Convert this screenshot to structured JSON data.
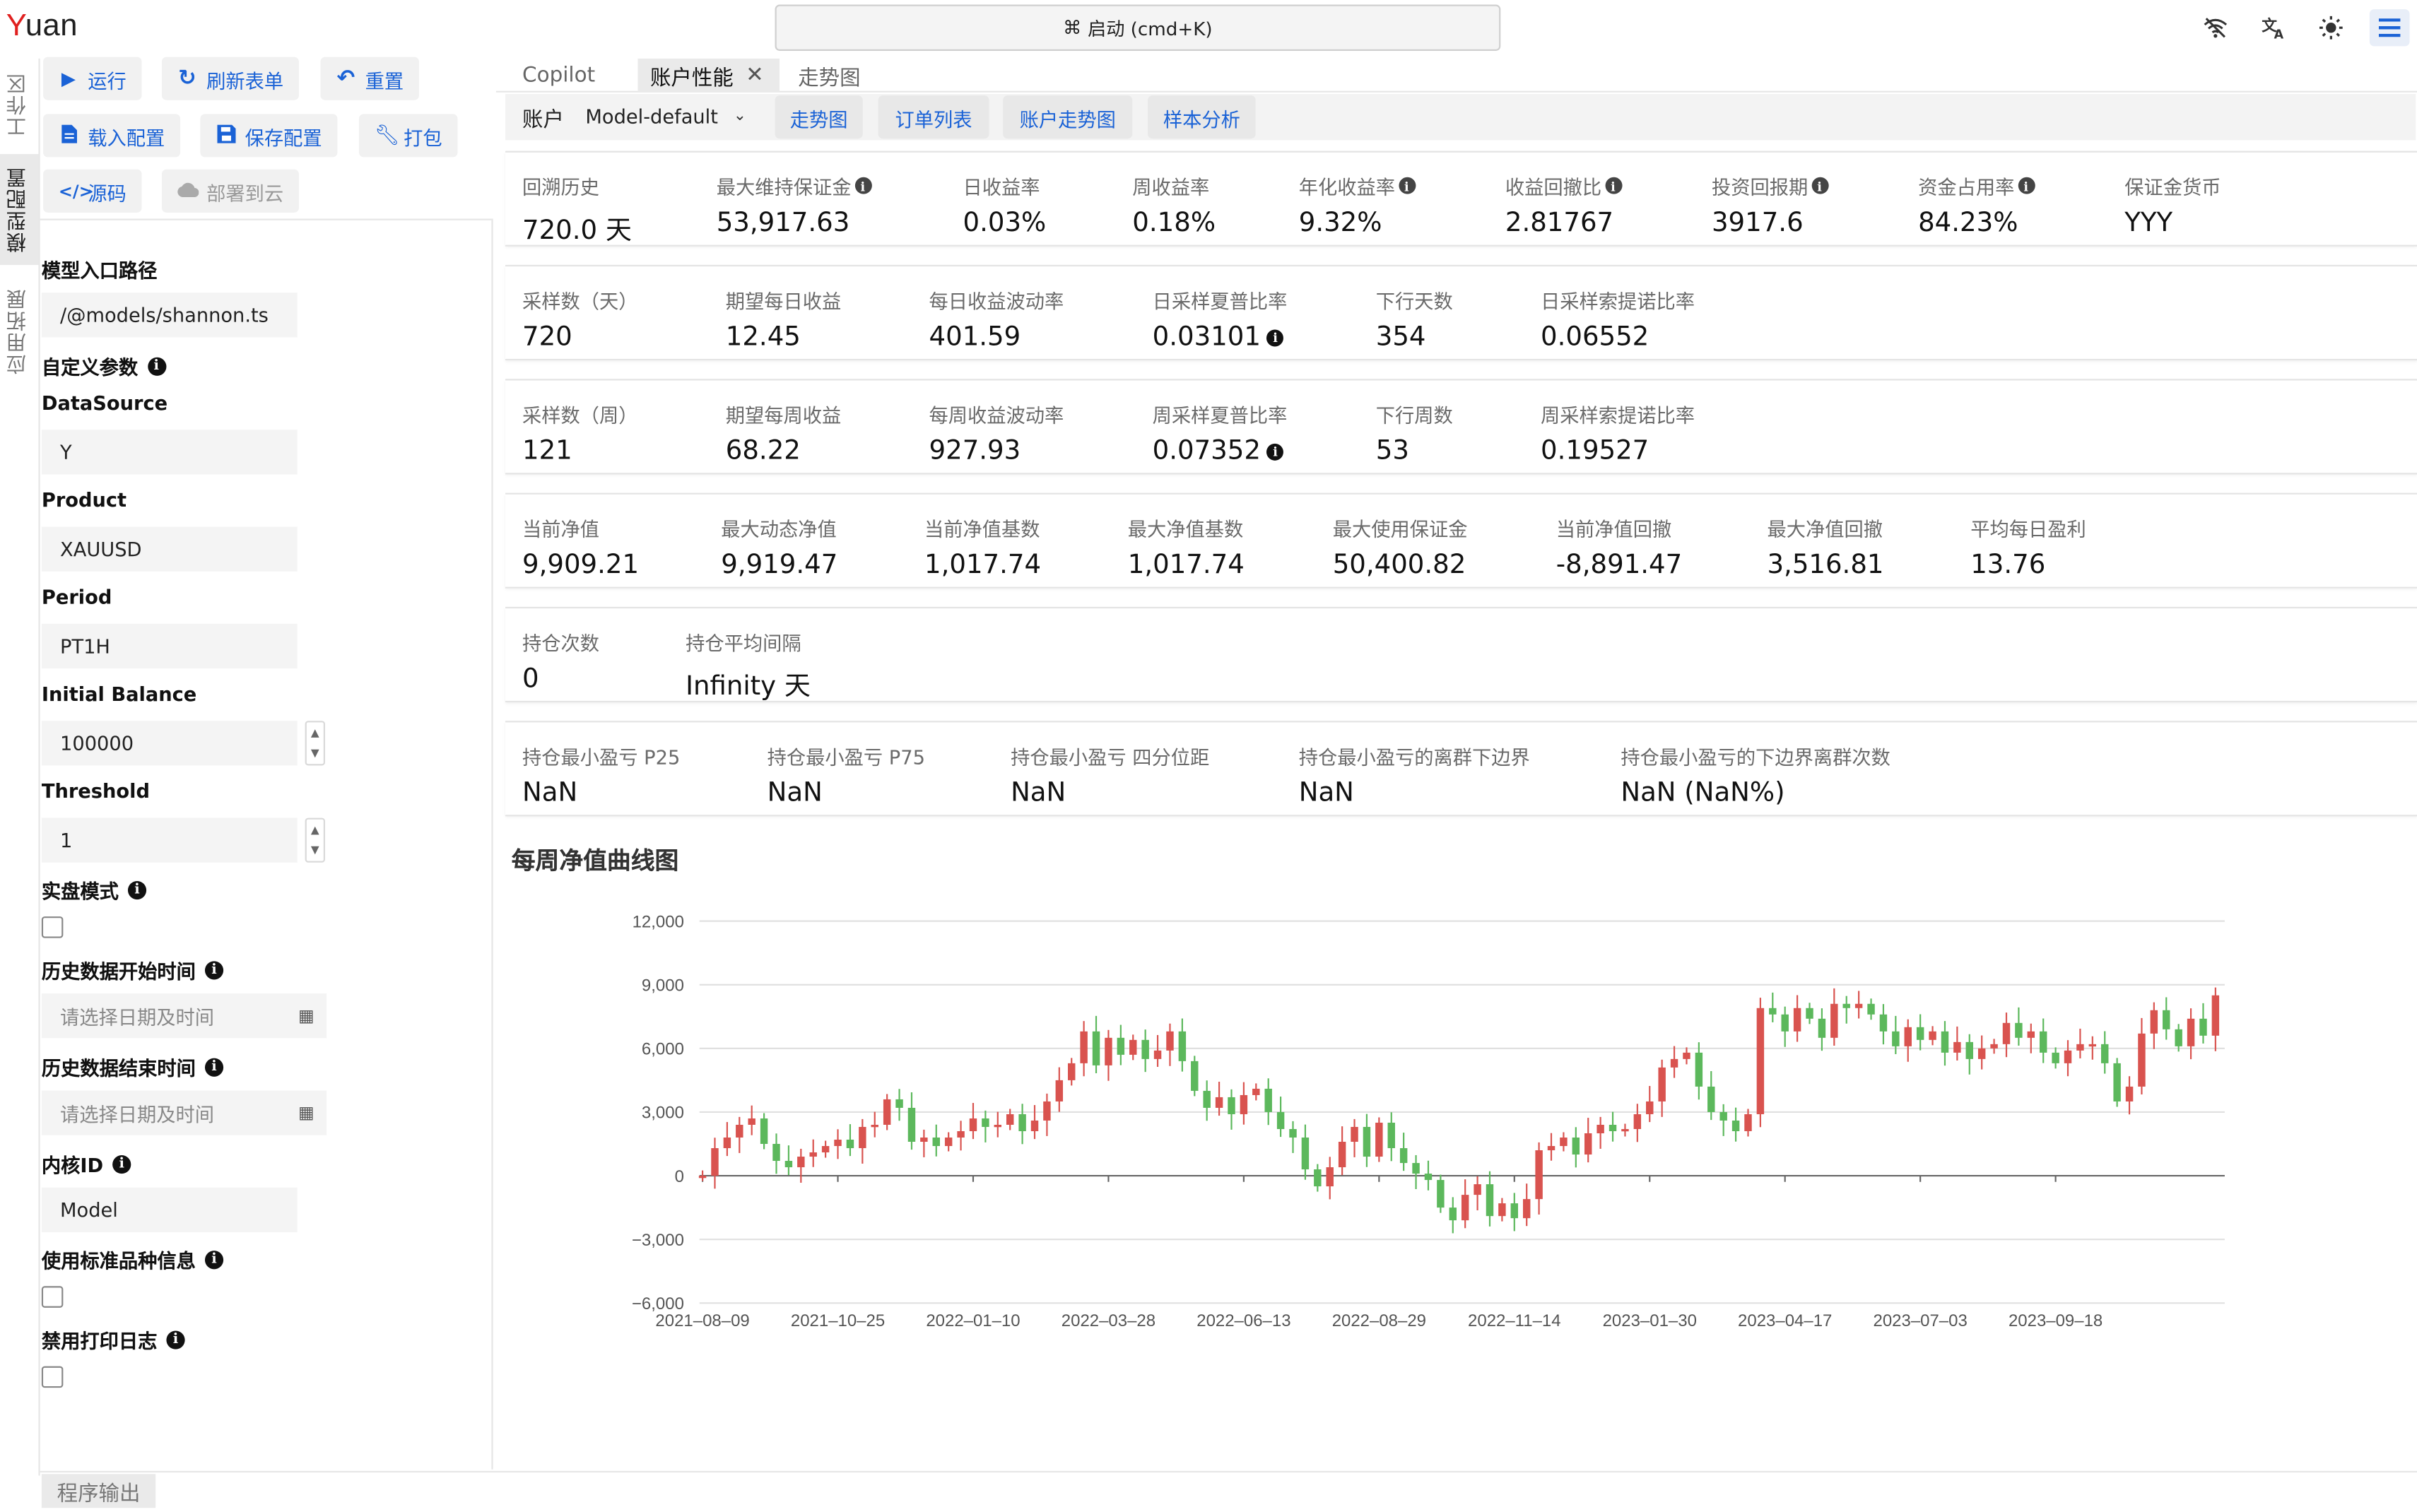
{
  "app": {
    "logo_first": "Y",
    "logo_rest": "uan"
  },
  "command": {
    "glyph": "⌘",
    "label": "启动 (cmd+K)"
  },
  "side_tabs": [
    "工作区",
    "模型配置",
    "应用拓展"
  ],
  "toolbar": {
    "run": "运行",
    "refresh": "刷新表单",
    "reset": "重置",
    "load": "载入配置",
    "save": "保存配置",
    "pack": "打包",
    "source": "源码",
    "deploy": "部署到云"
  },
  "form": {
    "entry_label": "模型入口路径",
    "entry_value": "/@models/shannon.ts",
    "custom_label": "自定义参数",
    "datasource_label": "DataSource",
    "datasource_value": "Y",
    "product_label": "Product",
    "product_value": "XAUUSD",
    "period_label": "Period",
    "period_value": "PT1H",
    "balance_label": "Initial Balance",
    "balance_value": "100000",
    "threshold_label": "Threshold",
    "threshold_value": "1",
    "live_label": "实盘模式",
    "start_label": "历史数据开始时间",
    "start_placeholder": "请选择日期及时间",
    "end_label": "历史数据结束时间",
    "end_placeholder": "请选择日期及时间",
    "kernel_label": "内核ID",
    "kernel_value": "Model",
    "std_label": "使用标准品种信息",
    "nolog_label": "禁用打印日志"
  },
  "main_tabs": [
    "Copilot",
    "账户性能",
    "走势图"
  ],
  "account": {
    "label": "账户",
    "select": "Model-default",
    "buttons": [
      "走势图",
      "订单列表",
      "账户走势图",
      "样本分析"
    ]
  },
  "cards": [
    [
      {
        "k": "回溯历史",
        "v": "720.0 天"
      },
      {
        "k": "最大维持保证金",
        "v": "53,917.63",
        "ki": true
      },
      {
        "k": "日收益率",
        "v": "0.03%"
      },
      {
        "k": "周收益率",
        "v": "0.18%"
      },
      {
        "k": "年化收益率",
        "v": "9.32%",
        "ki": true
      },
      {
        "k": "收益回撤比",
        "v": "2.81767",
        "ki": true
      },
      {
        "k": "投资回报期",
        "v": "3917.6",
        "ki": true
      },
      {
        "k": "资金占用率",
        "v": "84.23%",
        "ki": true
      },
      {
        "k": "保证金货币",
        "v": "YYY"
      }
    ],
    [
      {
        "k": "采样数（天）",
        "v": "720"
      },
      {
        "k": "期望每日收益",
        "v": "12.45"
      },
      {
        "k": "每日收益波动率",
        "v": "401.59"
      },
      {
        "k": "日采样夏普比率",
        "v": "0.03101",
        "vi": true
      },
      {
        "k": "下行天数",
        "v": "354"
      },
      {
        "k": "日采样索提诺比率",
        "v": "0.06552"
      }
    ],
    [
      {
        "k": "采样数（周）",
        "v": "121"
      },
      {
        "k": "期望每周收益",
        "v": "68.22"
      },
      {
        "k": "每周收益波动率",
        "v": "927.93"
      },
      {
        "k": "周采样夏普比率",
        "v": "0.07352",
        "vi": true
      },
      {
        "k": "下行周数",
        "v": "53"
      },
      {
        "k": "周采样索提诺比率",
        "v": "0.19527"
      }
    ],
    [
      {
        "k": "当前净值",
        "v": "9,909.21"
      },
      {
        "k": "最大动态净值",
        "v": "9,919.47"
      },
      {
        "k": "当前净值基数",
        "v": "1,017.74"
      },
      {
        "k": "最大净值基数",
        "v": "1,017.74"
      },
      {
        "k": "最大使用保证金",
        "v": "50,400.82"
      },
      {
        "k": "当前净值回撤",
        "v": "-8,891.47"
      },
      {
        "k": "最大净值回撤",
        "v": "3,516.81"
      },
      {
        "k": "平均每日盈利",
        "v": "13.76"
      }
    ],
    [
      {
        "k": "持仓次数",
        "v": "0"
      },
      {
        "k": "持仓平均间隔",
        "v": "Infinity 天"
      }
    ],
    [
      {
        "k": "持仓最小盈亏 P25",
        "v": "NaN"
      },
      {
        "k": "持仓最小盈亏 P75",
        "v": "NaN"
      },
      {
        "k": "持仓最小盈亏 四分位距",
        "v": "NaN"
      },
      {
        "k": "持仓最小盈亏的离群下边界",
        "v": "NaN"
      },
      {
        "k": "持仓最小盈亏的下边界离群次数",
        "v": "NaN (NaN%)"
      }
    ]
  ],
  "chart_title": "每周净值曲线图",
  "chart_data": {
    "type": "candlestick",
    "title": "每周净值曲线图",
    "xlabel": "",
    "ylabel": "",
    "ylim": [
      -6000,
      12000
    ],
    "yticks": [
      "12,000",
      "9,000",
      "6,000",
      "3,000",
      "0",
      "−3,000",
      "−6,000"
    ],
    "xticks": [
      "2021–08–09",
      "2021–10–25",
      "2022–01–10",
      "2022–03–28",
      "2022–06–13",
      "2022–08–29",
      "2022–11–14",
      "2023–01–30",
      "2023–04–17",
      "2023–07–03",
      "2023–09–18"
    ],
    "up_color": "#d9534f",
    "down_color": "#5cb85c",
    "closes": [
      0,
      1300,
      1800,
      2400,
      2700,
      1500,
      700,
      400,
      900,
      1100,
      1400,
      1700,
      1300,
      2300,
      2400,
      3600,
      3200,
      1600,
      1800,
      1400,
      1800,
      2100,
      2700,
      2300,
      2400,
      2900,
      2100,
      2600,
      3500,
      4500,
      5300,
      6800,
      5200,
      6500,
      5700,
      6400,
      5500,
      5900,
      6800,
      5400,
      4000,
      3200,
      3700,
      2900,
      3800,
      4100,
      3000,
      2200,
      1800,
      300,
      -500,
      400,
      1600,
      2300,
      900,
      2500,
      1300,
      600,
      100,
      -200,
      -1500,
      -2100,
      -900,
      -400,
      -1900,
      -1300,
      -2000,
      -1100,
      1200,
      1400,
      1800,
      1000,
      2000,
      2400,
      2100,
      2200,
      2900,
      3500,
      5100,
      5500,
      5800,
      4200,
      3000,
      2600,
      2100,
      2900,
      7900,
      7600,
      6800,
      7900,
      7400,
      6500,
      8100,
      7900,
      8100,
      7600,
      6800,
      6100,
      7000,
      6400,
      6800,
      5800,
      6300,
      5500,
      6000,
      6200,
      7200,
      6500,
      6800,
      5800,
      5300,
      5900,
      6200,
      6200,
      5300,
      3500,
      4200,
      6700,
      7800,
      6900,
      6100,
      7400,
      6600,
      8500
    ]
  },
  "output_tab": "程序输出"
}
